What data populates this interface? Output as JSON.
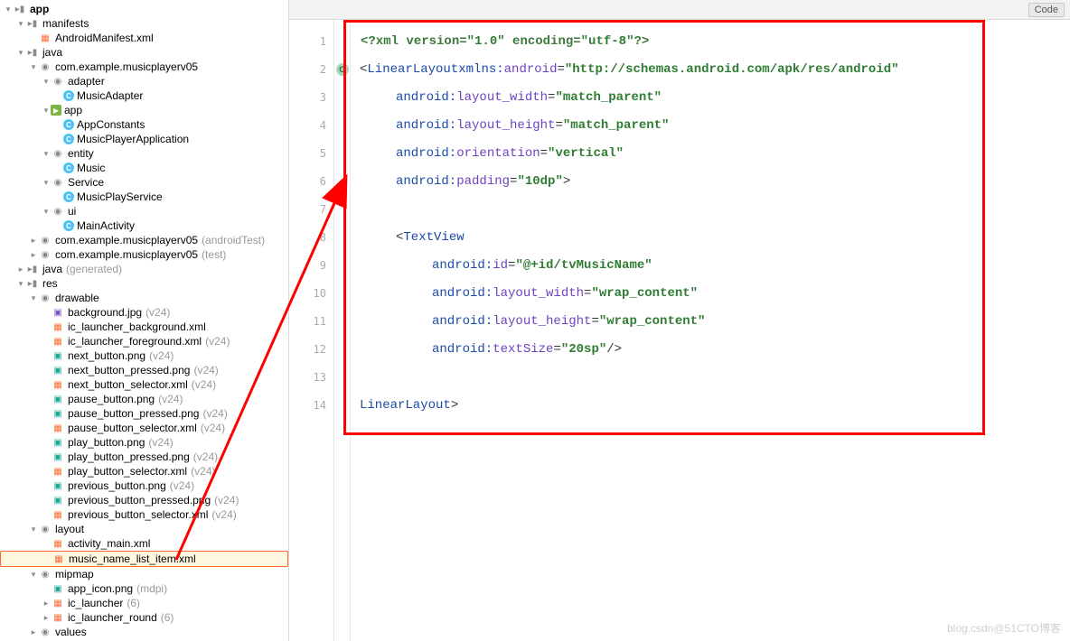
{
  "topbar": {
    "code_btn": "Code"
  },
  "watermark": "blog.csdn@51CTO博客",
  "gutter": [
    "1",
    "2",
    "3",
    "4",
    "5",
    "6",
    "7",
    "8",
    "9",
    "10",
    "11",
    "12",
    "13",
    "14"
  ],
  "code": {
    "l1": {
      "a": "<",
      "b": "?xml version=",
      "c": "\"1.0\"",
      "d": " encoding=",
      "e": "\"utf-8\"",
      "f": "?>"
    },
    "l2": {
      "a": "<",
      "b": "LinearLayout",
      "sp": " ",
      "ns": "xmlns:",
      "attr": "android",
      "eq": "=",
      "val": "\"http://schemas.android.com/apk/res/android\""
    },
    "l3": {
      "ns": "android:",
      "attr": "layout_width",
      "eq": "=",
      "val": "\"match_parent\""
    },
    "l4": {
      "ns": "android:",
      "attr": "layout_height",
      "eq": "=",
      "val": "\"match_parent\""
    },
    "l5": {
      "ns": "android:",
      "attr": "orientation",
      "eq": "=",
      "val": "\"vertical\""
    },
    "l6": {
      "ns": "android:",
      "attr": "padding",
      "eq": "=",
      "val": "\"10dp\"",
      "end": ">"
    },
    "l8": {
      "a": "<",
      "b": "TextView"
    },
    "l9": {
      "ns": "android:",
      "attr": "id",
      "eq": "=",
      "val": "\"@+id/tvMusicName\""
    },
    "l10": {
      "ns": "android:",
      "attr": "layout_width",
      "eq": "=",
      "val": "\"wrap_content\""
    },
    "l11": {
      "ns": "android:",
      "attr": "layout_height",
      "eq": "=",
      "val": "\"wrap_content\""
    },
    "l12": {
      "ns": "android:",
      "attr": "textSize",
      "eq": "=",
      "val": "\"20sp\"",
      "end": "/>"
    },
    "l14": {
      "a": "</",
      "b": "LinearLayout",
      "c": ">"
    }
  },
  "tree": [
    {
      "d": 0,
      "exp": "▾",
      "ic": "folder",
      "label": "app",
      "bold": true
    },
    {
      "d": 1,
      "exp": "▾",
      "ic": "folder",
      "label": "manifests"
    },
    {
      "d": 2,
      "exp": "",
      "ic": "xml",
      "label": "AndroidManifest.xml"
    },
    {
      "d": 1,
      "exp": "▾",
      "ic": "folder",
      "label": "java"
    },
    {
      "d": 2,
      "exp": "▾",
      "ic": "pkg",
      "label": "com.example.musicplayerv05"
    },
    {
      "d": 3,
      "exp": "▾",
      "ic": "pkg",
      "label": "adapter"
    },
    {
      "d": 4,
      "exp": "",
      "ic": "class",
      "label": "MusicAdapter"
    },
    {
      "d": 3,
      "exp": "▾",
      "ic": "gpkg",
      "label": "app"
    },
    {
      "d": 4,
      "exp": "",
      "ic": "class",
      "label": "AppConstants"
    },
    {
      "d": 4,
      "exp": "",
      "ic": "class",
      "label": "MusicPlayerApplication"
    },
    {
      "d": 3,
      "exp": "▾",
      "ic": "pkg",
      "label": "entity"
    },
    {
      "d": 4,
      "exp": "",
      "ic": "class",
      "label": "Music"
    },
    {
      "d": 3,
      "exp": "▾",
      "ic": "pkg",
      "label": "Service"
    },
    {
      "d": 4,
      "exp": "",
      "ic": "class",
      "label": "MusicPlayService"
    },
    {
      "d": 3,
      "exp": "▾",
      "ic": "pkg",
      "label": "ui"
    },
    {
      "d": 4,
      "exp": "",
      "ic": "class",
      "label": "MainActivity"
    },
    {
      "d": 2,
      "exp": "▸",
      "ic": "pkg",
      "label": "com.example.musicplayerv05",
      "hint": "(androidTest)"
    },
    {
      "d": 2,
      "exp": "▸",
      "ic": "pkg",
      "label": "com.example.musicplayerv05",
      "hint": "(test)"
    },
    {
      "d": 1,
      "exp": "▸",
      "ic": "folder",
      "label": "java",
      "hint": "(generated)"
    },
    {
      "d": 1,
      "exp": "▾",
      "ic": "folder",
      "label": "res"
    },
    {
      "d": 2,
      "exp": "▾",
      "ic": "pkg",
      "label": "drawable"
    },
    {
      "d": 3,
      "exp": "",
      "ic": "img",
      "label": "background.jpg",
      "hint": "(v24)"
    },
    {
      "d": 3,
      "exp": "",
      "ic": "xml",
      "label": "ic_launcher_background.xml"
    },
    {
      "d": 3,
      "exp": "",
      "ic": "xml",
      "label": "ic_launcher_foreground.xml",
      "hint": "(v24)"
    },
    {
      "d": 3,
      "exp": "",
      "ic": "png",
      "label": "next_button.png",
      "hint": "(v24)"
    },
    {
      "d": 3,
      "exp": "",
      "ic": "png",
      "label": "next_button_pressed.png",
      "hint": "(v24)"
    },
    {
      "d": 3,
      "exp": "",
      "ic": "xml",
      "label": "next_button_selector.xml",
      "hint": "(v24)"
    },
    {
      "d": 3,
      "exp": "",
      "ic": "png",
      "label": "pause_button.png",
      "hint": "(v24)"
    },
    {
      "d": 3,
      "exp": "",
      "ic": "png",
      "label": "pause_button_pressed.png",
      "hint": "(v24)"
    },
    {
      "d": 3,
      "exp": "",
      "ic": "xml",
      "label": "pause_button_selector.xml",
      "hint": "(v24)"
    },
    {
      "d": 3,
      "exp": "",
      "ic": "png",
      "label": "play_button.png",
      "hint": "(v24)"
    },
    {
      "d": 3,
      "exp": "",
      "ic": "png",
      "label": "play_button_pressed.png",
      "hint": "(v24)"
    },
    {
      "d": 3,
      "exp": "",
      "ic": "xml",
      "label": "play_button_selector.xml",
      "hint": "(v24)"
    },
    {
      "d": 3,
      "exp": "",
      "ic": "png",
      "label": "previous_button.png",
      "hint": "(v24)"
    },
    {
      "d": 3,
      "exp": "",
      "ic": "png",
      "label": "previous_button_pressed.png",
      "hint": "(v24)"
    },
    {
      "d": 3,
      "exp": "",
      "ic": "xml",
      "label": "previous_button_selector.xml",
      "hint": "(v24)"
    },
    {
      "d": 2,
      "exp": "▾",
      "ic": "pkg",
      "label": "layout"
    },
    {
      "d": 3,
      "exp": "",
      "ic": "xml",
      "label": "activity_main.xml"
    },
    {
      "d": 3,
      "exp": "",
      "ic": "xml",
      "label": "music_name_list_item.xml",
      "selected": true
    },
    {
      "d": 2,
      "exp": "▾",
      "ic": "pkg",
      "label": "mipmap"
    },
    {
      "d": 3,
      "exp": "",
      "ic": "png",
      "label": "app_icon.png",
      "hint": "(mdpi)"
    },
    {
      "d": 3,
      "exp": "▸",
      "ic": "xml",
      "label": "ic_launcher",
      "hint": "(6)"
    },
    {
      "d": 3,
      "exp": "▸",
      "ic": "xml",
      "label": "ic_launcher_round",
      "hint": "(6)"
    },
    {
      "d": 2,
      "exp": "▸",
      "ic": "pkg",
      "label": "values"
    }
  ]
}
